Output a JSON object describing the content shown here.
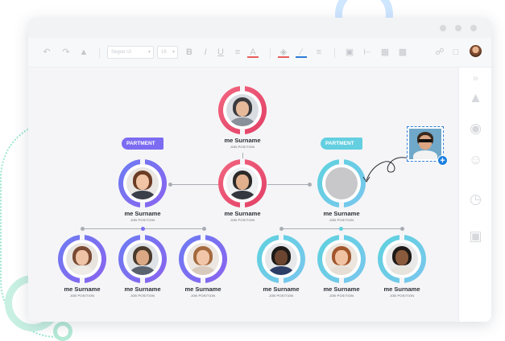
{
  "toolbar": {
    "font_name": "Segoe UI",
    "font_size": "16",
    "undo_icon": "undo-icon",
    "redo_icon": "redo-icon",
    "paint_icon": "format-painter-icon",
    "bold": "B",
    "italic": "I",
    "underline": "U"
  },
  "badges": {
    "left": "PARTMENT",
    "right": "PARTMENT"
  },
  "nodes": [
    {
      "name": "me Surname",
      "position": "JOB POSITION"
    },
    {
      "name": "me Surname",
      "position": "JOB POSITION"
    },
    {
      "name": "me Surname",
      "position": "JOB POSITION"
    },
    {
      "name": "me Surname",
      "position": "JOB POSITION"
    },
    {
      "name": "me Surname",
      "position": "JOB POSITION"
    },
    {
      "name": "me Surname",
      "position": "JOB POSITION"
    },
    {
      "name": "me Surname",
      "position": "JOB POSITION"
    },
    {
      "name": "me Surname",
      "position": "JOB POSITION"
    },
    {
      "name": "me Surname",
      "position": "JOB POSITION"
    },
    {
      "name": "me Surname",
      "position": "JOB POSITION"
    }
  ],
  "colors": {
    "red_ring": "#ea4a6a",
    "purple_ring": "#7b6ff0",
    "teal_ring": "#5ed2de",
    "badge_purple": "#7c6cf2",
    "badge_teal": "#63cfe0",
    "accent_blue": "#1a7fe0"
  },
  "side_panel_icons": [
    "collapse-icon",
    "shirt-icon",
    "palette-icon",
    "emoji-icon",
    "clock-icon",
    "comment-icon"
  ]
}
